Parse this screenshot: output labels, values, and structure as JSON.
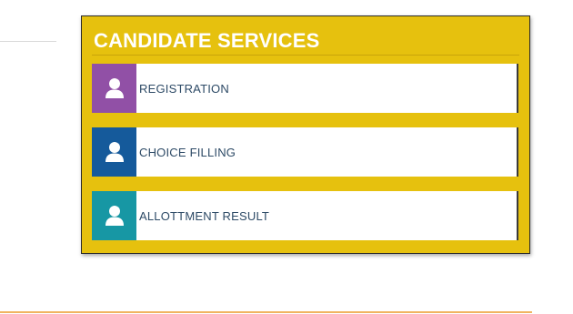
{
  "panel": {
    "title": "CANDIDATE SERVICES",
    "background_color": "#e6c10e"
  },
  "services": [
    {
      "label": "REGISTRATION",
      "icon": "user-icon",
      "icon_bg": "#9150a6"
    },
    {
      "label": "CHOICE FILLING",
      "icon": "user-icon",
      "icon_bg": "#155a9b"
    },
    {
      "label": "ALLOTTMENT RESULT",
      "icon": "user-icon",
      "icon_bg": "#1797a4"
    }
  ],
  "colors": {
    "label_text": "#2d4a66",
    "bottom_rule": "#f0b461"
  }
}
